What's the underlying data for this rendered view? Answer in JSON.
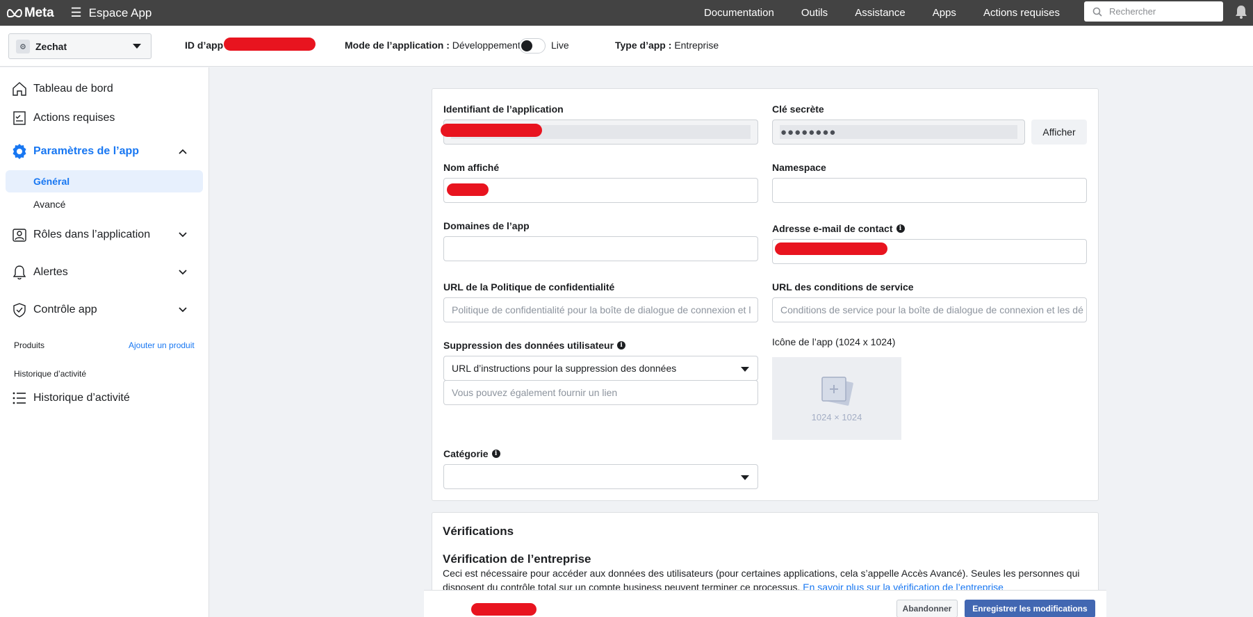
{
  "topbar": {
    "brand": "Meta",
    "section": "Espace App",
    "nav": [
      "Documentation",
      "Outils",
      "Assistance",
      "Apps",
      "Actions requises"
    ],
    "search_placeholder": "Rechercher"
  },
  "subheader": {
    "app_name": "Zechat",
    "app_id_label": "ID d’app :",
    "mode_label": "Mode de l’application :",
    "mode_dev": "Développement",
    "mode_live": "Live",
    "mode_live_enabled": false,
    "type_label": "Type d’app :",
    "type_value": "Entreprise"
  },
  "sidebar": {
    "dashboard": "Tableau de bord",
    "required_actions": "Actions requises",
    "app_settings": "Paramètres de l’app",
    "general": "Général",
    "advanced": "Avancé",
    "roles": "Rôles dans l’application",
    "alerts": "Alertes",
    "app_review": "Contrôle app",
    "products_head": "Produits",
    "add_product": "Ajouter un produit",
    "activity_head": "Historique d’activité",
    "activity_log": "Historique d’activité",
    "accent": "#1877f2"
  },
  "form": {
    "app_id_label": "Identifiant de l’application",
    "secret_label": "Clé secrète",
    "secret_value": "●●●●●●●●",
    "show_button": "Afficher",
    "display_name_label": "Nom affiché",
    "namespace_label": "Namespace",
    "domains_label": "Domaines de l’app",
    "contact_email_label": "Adresse e-mail de contact",
    "privacy_label": "URL de la Politique de confidentialité",
    "privacy_placeholder": "Politique de confidentialité pour la boîte de dialogue de connexion et l",
    "tos_label": "URL des conditions de service",
    "tos_placeholder": "Conditions de service pour la boîte de dialogue de connexion et les dé",
    "deletion_label": "Suppression des données utilisateur",
    "deletion_select": "URL d’instructions pour la suppression des données",
    "deletion_placeholder": "Vous pouvez également fournir un lien",
    "icon_label": "Icône de l’app (1024 x 1024)",
    "icon_size": "1024 × 1024",
    "category_label": "Catégorie",
    "category_value": ""
  },
  "verifications": {
    "title": "Vérifications",
    "business_title": "Vérification de l’entreprise",
    "text_1": "Ceci est nécessaire pour accéder aux données des utilisateurs (pour certaines applications, cela s’appelle Accès Avancé). Seules les personnes qui",
    "text_2": "disposent du contrôle total sur un compte business peuvent terminer ce processus. ",
    "learn_more": "En savoir plus sur la vérification de l’entreprise"
  },
  "footer": {
    "cancel": "Abandonner",
    "save": "Enregistrer les modifications",
    "save_color": "#4267b2"
  }
}
